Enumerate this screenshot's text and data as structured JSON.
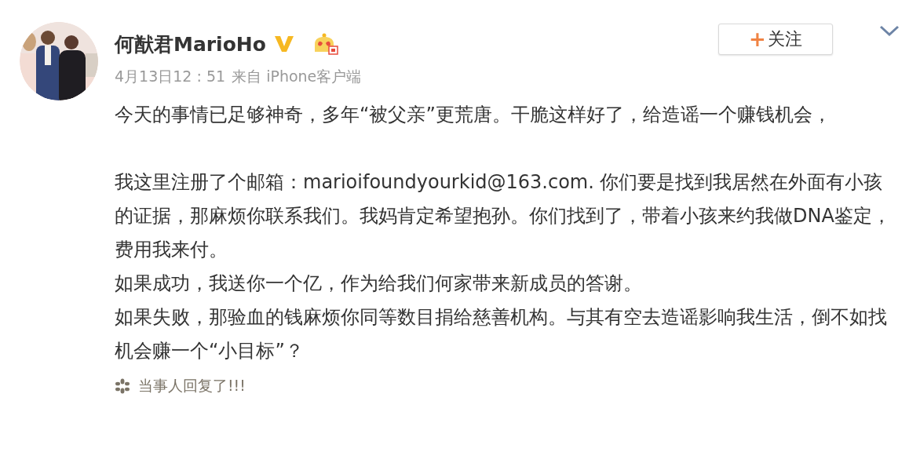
{
  "post": {
    "author": "何猷君MarioHo",
    "time": "4月13日12 : 51",
    "source": "来自 iPhone客户端",
    "follow_button": {
      "icon": "+",
      "label": "关注"
    },
    "paragraphs": [
      "今天的事情已足够神奇，多年“被父亲”更荒唐。干脆这样好了，给造谣一个赚钱机会，",
      "我这里注册了个邮箱：marioifoundyourkid@163.com. 你们要是找到我居然在外面有小孩的证据，那麻烦你联系我们。我妈肯定希望抱孙。你们找到了，带着小孩来约我做DNA鉴定，费用我来付。",
      "如果成功，我送你一个亿，作为给我们何家带来新成员的答谢。",
      "如果失败，那验血的钱麻烦你同等数目捐给慈善机构。与其有空去造谣影响我生活，倒不如找机会赚一个“小目标”？"
    ],
    "footer": "当事人回复了!!!"
  }
}
